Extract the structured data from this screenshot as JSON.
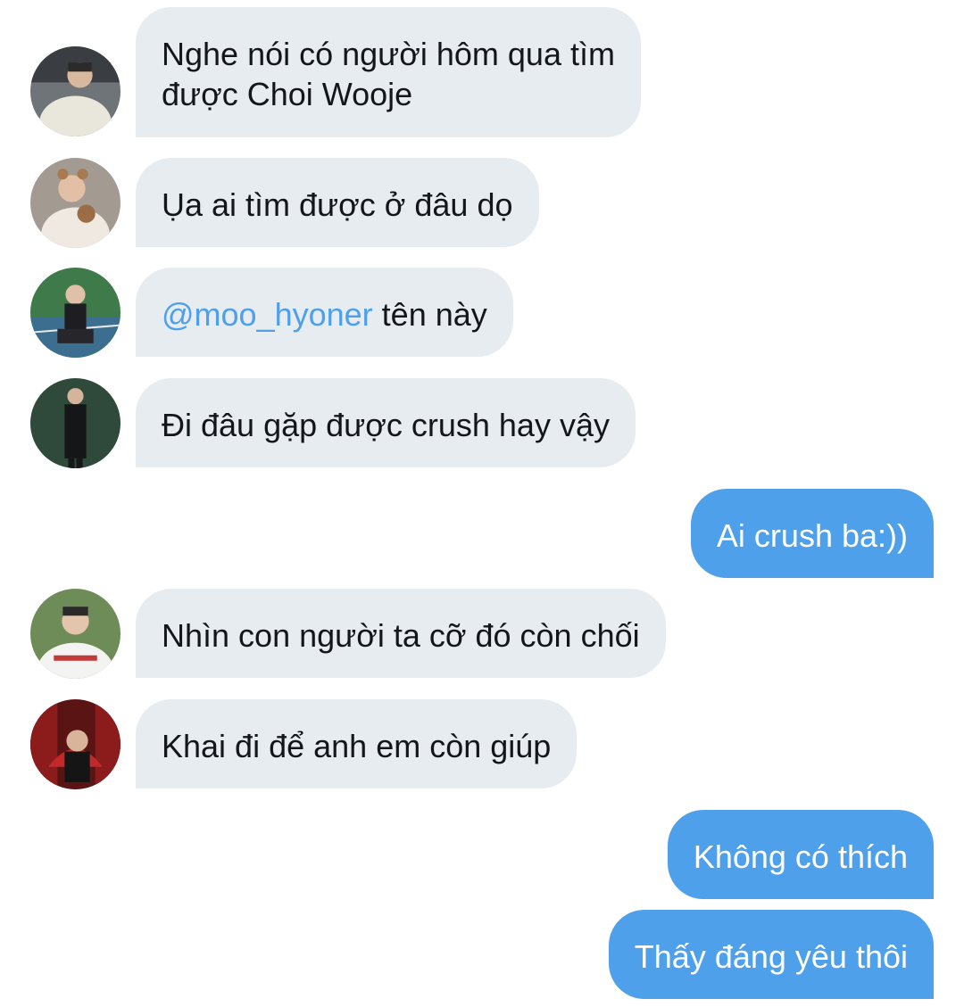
{
  "colors": {
    "incoming_bubble": "#e6ecf0",
    "outgoing_bubble": "#4fa0ea",
    "mention": "#4fa0ea",
    "text": "#14171a"
  },
  "messages": [
    {
      "direction": "incoming",
      "lines": [
        "Nghe nói có người hôm qua tìm",
        "được Choi Wooje"
      ]
    },
    {
      "direction": "incoming",
      "text": "Ụa ai tìm được ở đâu dọ"
    },
    {
      "direction": "incoming",
      "mention": "@moo_hyoner",
      "text": " tên này"
    },
    {
      "direction": "incoming",
      "text": "Đi đâu gặp được crush hay vậy"
    },
    {
      "direction": "outgoing",
      "text": "Ai crush ba:))"
    },
    {
      "direction": "incoming",
      "text": "Nhìn con người ta cỡ đó còn chối"
    },
    {
      "direction": "incoming",
      "text": "Khai đi để anh em còn giúp"
    },
    {
      "direction": "outgoing",
      "text": "Không có thích"
    },
    {
      "direction": "outgoing",
      "text": "Thấy đáng yêu thôi"
    }
  ]
}
